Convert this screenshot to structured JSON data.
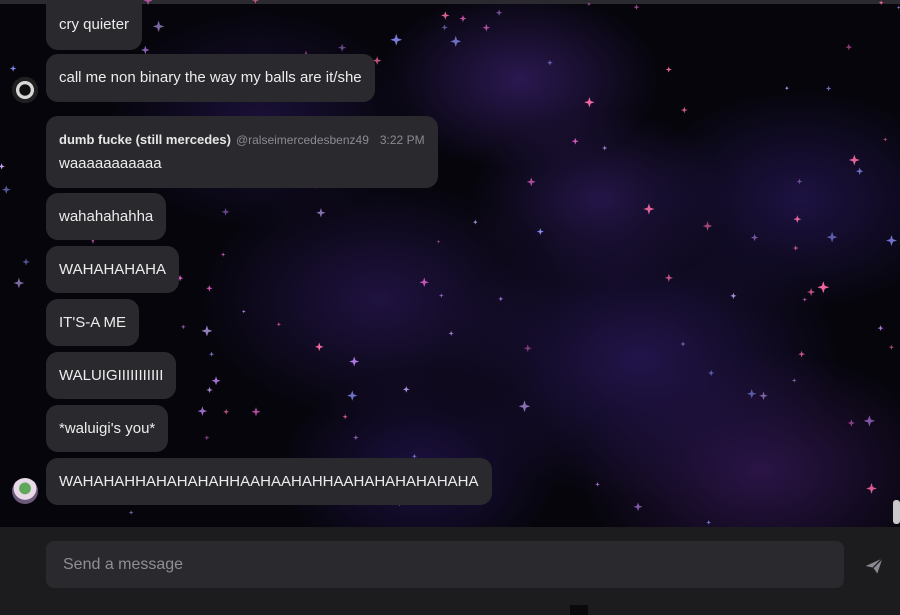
{
  "messages": [
    {
      "text": "cry quieter"
    },
    {
      "text": "call me non binary the way my balls are it/she"
    },
    {
      "author": "dumb fucke (still mercedes)",
      "handle": "@ralseimercedesbenz49",
      "time": "3:22 PM",
      "text": "waaaaaaaaaaa"
    },
    {
      "text": "wahahahahha"
    },
    {
      "text": "WAHAHAHAHA"
    },
    {
      "text": "IT'S-A ME"
    },
    {
      "text": "WALUIGIIIIIIIIIII"
    },
    {
      "text": "*waluigi's you*"
    },
    {
      "text": "WAHAHAHHAHAHAHAHHAAHAAHAHHAAHAHAHAHAHAHA"
    }
  ],
  "composer": {
    "placeholder": "Send a message"
  },
  "icons": {
    "send": "send-icon",
    "avatar": "avatar"
  },
  "colors": {
    "bubble": "#2a2a2e",
    "accent": "#e061c8",
    "background": "#06050c"
  }
}
